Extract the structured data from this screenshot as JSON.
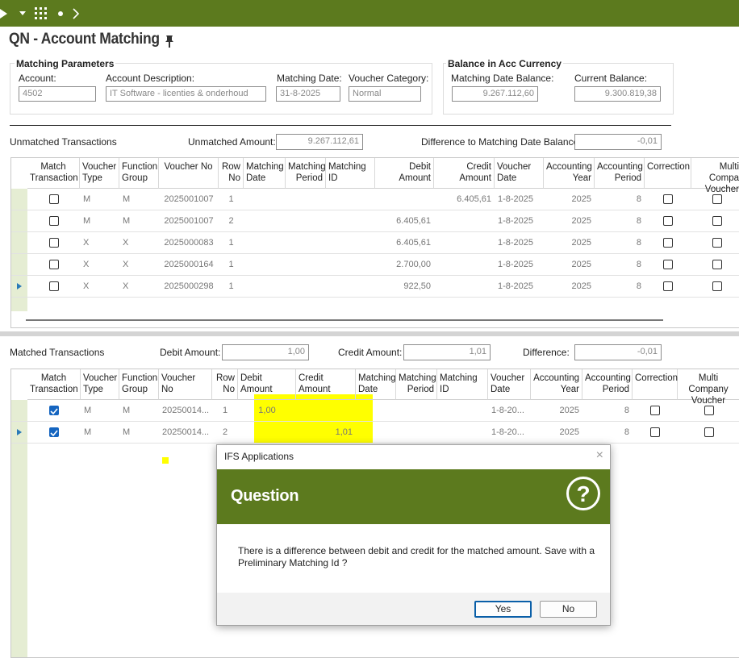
{
  "page_title": "QN - Account Matching",
  "matching_parameters": {
    "title": "Matching Parameters",
    "account_label": "Account:",
    "account_value": "4502",
    "description_label": "Account Description:",
    "description_value": "IT Software - licenties & onderhoud",
    "date_label": "Matching Date:",
    "date_value": "31-8-2025",
    "category_label": "Voucher Category:",
    "category_value": "Normal"
  },
  "balance": {
    "title": "Balance in Acc Currency",
    "matching_date_balance_label": "Matching Date Balance:",
    "matching_date_balance_value": "9.267.112,60",
    "current_balance_label": "Current Balance:",
    "current_balance_value": "9.300.819,38"
  },
  "unmatched": {
    "title": "Unmatched Transactions",
    "amount_label": "Unmatched Amount:",
    "amount_value": "9.267.112,61",
    "difference_label": "Difference to Matching Date Balance:",
    "difference_value": "-0,01",
    "headers": [
      "Match Transaction",
      "Voucher Type",
      "Function Group",
      "Voucher No",
      "Row No",
      "Matching Date",
      "Matching Period",
      "Matching ID",
      "Debit Amount",
      "Credit Amount",
      "Voucher Date",
      "Accounting Year",
      "Accounting Period",
      "Correction",
      "Multi Compa Voucher"
    ],
    "rows": [
      {
        "type": "M",
        "group": "M",
        "voucher": "2025001007",
        "row": "1",
        "debit": "",
        "credit": "6.405,61",
        "vdate": "1-8-2025",
        "year": "2025",
        "period": "8"
      },
      {
        "type": "M",
        "group": "M",
        "voucher": "2025001007",
        "row": "2",
        "debit": "6.405,61",
        "credit": "",
        "vdate": "1-8-2025",
        "year": "2025",
        "period": "8"
      },
      {
        "type": "X",
        "group": "X",
        "voucher": "2025000083",
        "row": "1",
        "debit": "6.405,61",
        "credit": "",
        "vdate": "1-8-2025",
        "year": "2025",
        "period": "8"
      },
      {
        "type": "X",
        "group": "X",
        "voucher": "2025000164",
        "row": "1",
        "debit": "2.700,00",
        "credit": "",
        "vdate": "1-8-2025",
        "year": "2025",
        "period": "8"
      },
      {
        "type": "X",
        "group": "X",
        "voucher": "2025000298",
        "row": "1",
        "debit": "922,50",
        "credit": "",
        "vdate": "1-8-2025",
        "year": "2025",
        "period": "8"
      }
    ]
  },
  "matched": {
    "title": "Matched Transactions",
    "debit_label": "Debit Amount:",
    "debit_value": "1,00",
    "credit_label": "Credit Amount:",
    "credit_value": "1,01",
    "difference_label": "Difference:",
    "difference_value": "-0,01",
    "headers": [
      "Match Transaction",
      "Voucher Type",
      "Function Group",
      "Voucher No",
      "Row No",
      "Debit Amount",
      "Credit Amount",
      "Matching Date",
      "Matching Period",
      "Matching ID",
      "Voucher Date",
      "Accounting Year",
      "Accounting Period",
      "Correction",
      "Multi Company Voucher"
    ],
    "rows": [
      {
        "type": "M",
        "group": "M",
        "voucher": "20250014...",
        "row": "1",
        "debit": "1,00",
        "credit": "",
        "vdate": "1-8-20...",
        "year": "2025",
        "period": "8"
      },
      {
        "type": "M",
        "group": "M",
        "voucher": "20250014...",
        "row": "2",
        "debit": "",
        "credit": "1,01",
        "vdate": "1-8-20...",
        "year": "2025",
        "period": "8"
      }
    ]
  },
  "dialog": {
    "title": "IFS Applications",
    "heading": "Question",
    "message": "There is a difference between debit and credit for the matched amount. Save with a Preliminary Matching Id ?",
    "yes_label": "Yes",
    "no_label": "No",
    "question_glyph": "?",
    "close_glyph": "×"
  },
  "colors": {
    "brand": "#5c7a1e",
    "highlight": "#ffff00",
    "checkbox": "#1565c0"
  },
  "icons": [
    "play-icon",
    "dropdown-icon",
    "grid-menu-icon",
    "dot-icon",
    "chevron-right-icon",
    "pin-icon",
    "question-icon",
    "close-icon",
    "check-icon",
    "row-pointer-icon"
  ]
}
